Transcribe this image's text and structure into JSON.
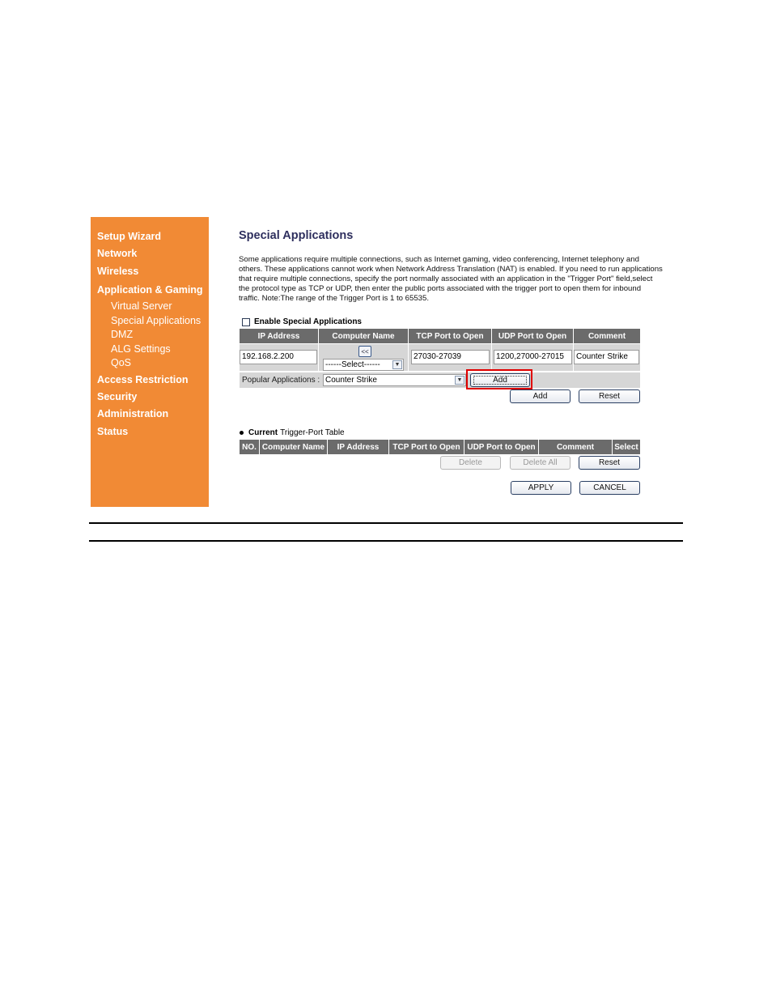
{
  "sidebar": {
    "items": [
      {
        "label": "Setup Wizard"
      },
      {
        "label": "Network"
      },
      {
        "label": "Wireless"
      },
      {
        "label": "Application & Gaming"
      },
      {
        "label": "Access Restriction"
      },
      {
        "label": "Security"
      },
      {
        "label": "Administration"
      },
      {
        "label": "Status"
      }
    ],
    "subitems": [
      {
        "label": "Virtual Server"
      },
      {
        "label": "Special Applications"
      },
      {
        "label": "DMZ"
      },
      {
        "label": "ALG Settings"
      },
      {
        "label": "QoS"
      }
    ],
    "color": "#f18a35"
  },
  "main": {
    "title": "Special Applications",
    "description": "Some applications require multiple connections, such as Internet gaming, video conferencing, Internet telephony and others. These applications cannot work when Network Address Translation (NAT) is enabled. If you need to run applications that require multiple connections, specify the port normally associated with an application in the \"Trigger Port\" field,select the protocol type as TCP or UDP, then enter the public ports associated with the trigger port to open them for inbound traffic. Note:The range of the Trigger Port is 1 to 65535.",
    "enable_label": "Enable Special Applications",
    "enable_checked": false
  },
  "form": {
    "headers": [
      "IP Address",
      "Computer Name",
      "TCP Port to Open",
      "UDP Port to Open",
      "Comment"
    ],
    "ip_address": "192.168.2.200",
    "copy_button": "<<",
    "computer_name_select": "------Select------",
    "tcp_port": "27030-27039",
    "udp_port": "1200,27000-27015",
    "comment": "Counter Strike",
    "popular_label": "Popular Applications :",
    "popular_value": "Counter Strike",
    "popular_add": "Add",
    "add_button": "Add",
    "reset_button": "Reset"
  },
  "table": {
    "title_bold": "Current",
    "title_rest": "Trigger-Port Table",
    "headers": [
      "NO.",
      "Computer Name",
      "IP Address",
      "TCP Port to Open",
      "UDP Port to Open",
      "Comment",
      "Select"
    ],
    "rows": [],
    "delete_button": "Delete",
    "delete_all_button": "Delete All",
    "reset_button": "Reset"
  },
  "footer": {
    "apply_button": "APPLY",
    "cancel_button": "CANCEL"
  },
  "highlight_color": "#e00000"
}
